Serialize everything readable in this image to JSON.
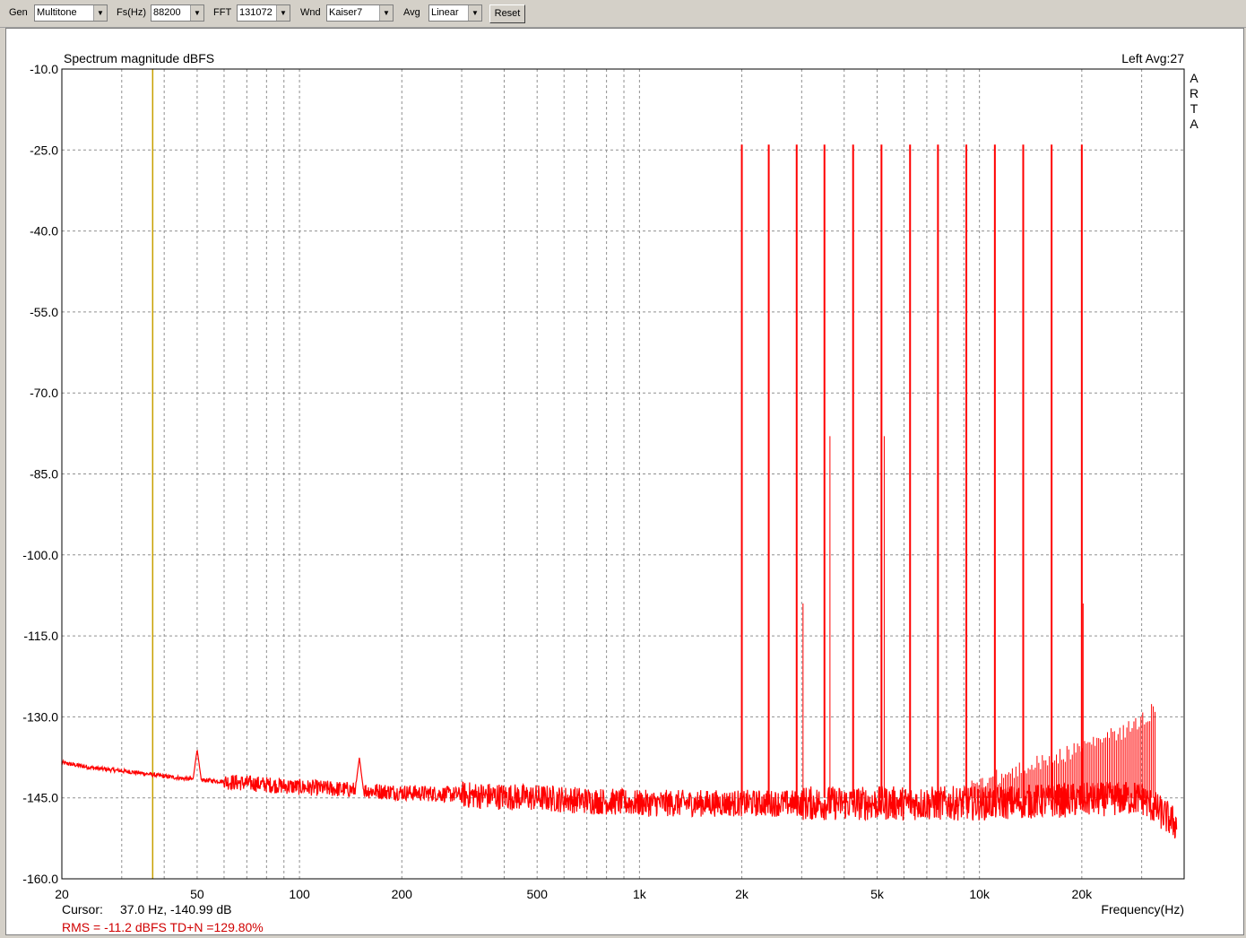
{
  "toolbar": {
    "gen_label": "Gen",
    "gen_value": "Multitone",
    "fs_label": "Fs(Hz)",
    "fs_value": "88200",
    "fft_label": "FFT",
    "fft_value": "131072",
    "wnd_label": "Wnd",
    "wnd_value": "Kaiser7",
    "avg_label": "Avg",
    "avg_value": "Linear",
    "reset_label": "Reset"
  },
  "chart": {
    "title": "Spectrum magnitude dBFS",
    "channel_info": "Left  Avg:27",
    "brand": "ARTA",
    "xlabel": "Frequency(Hz)",
    "cursor_label": "Cursor:",
    "cursor_value": "37.0 Hz, -140.99 dB",
    "rms_text": "RMS =  -11.2 dBFS   TD+N =129.80%"
  },
  "colors": {
    "trace": "#ff0000",
    "cursor": "#c8a000",
    "grid": "#909090",
    "status": "#d00000"
  },
  "chart_data": {
    "type": "line",
    "xscale": "log",
    "xlim": [
      20,
      40000
    ],
    "ylim": [
      -160,
      -10
    ],
    "x_ticks": [
      20,
      50,
      100,
      200,
      500,
      1000,
      2000,
      5000,
      10000,
      20000
    ],
    "x_tick_labels": [
      "20",
      "50",
      "100",
      "200",
      "500",
      "1k",
      "2k",
      "5k",
      "10k",
      "20k"
    ],
    "y_ticks": [
      -10,
      -25,
      -40,
      -55,
      -70,
      -85,
      -100,
      -115,
      -130,
      -145,
      -160
    ],
    "y_tick_labels": [
      "-10.0",
      "-25.0",
      "-40.0",
      "-55.0",
      "-70.0",
      "-85.0",
      "-100.0",
      "-115.0",
      "-130.0",
      "-145.0",
      "-160.0"
    ],
    "grid": true,
    "cursor_hz": 37.0,
    "tones_hz": [
      2000,
      2400,
      2900,
      3500,
      4250,
      5150,
      6250,
      7550,
      9150,
      11100,
      13450,
      16300,
      20000
    ],
    "tone_level_db": -24,
    "noise_floor_db": -145,
    "low_freq_noise": [
      [
        20,
        -138.5
      ],
      [
        25,
        -139.5
      ],
      [
        30,
        -140
      ],
      [
        35,
        -140.5
      ],
      [
        40,
        -141
      ],
      [
        47,
        -141.5
      ],
      [
        100,
        -143
      ],
      [
        200,
        -144
      ],
      [
        500,
        -145
      ],
      [
        1000,
        -146
      ],
      [
        2000,
        -146
      ],
      [
        10000,
        -146
      ],
      [
        30000,
        -145
      ],
      [
        38000,
        -150
      ]
    ],
    "spurs": [
      [
        50,
        -136
      ],
      [
        150,
        -137.5
      ],
      [
        3000,
        -109
      ],
      [
        3600,
        -78
      ],
      [
        5200,
        -78
      ],
      [
        20000,
        -109
      ]
    ],
    "imd_products_envelope": [
      [
        9500,
        -141
      ],
      [
        15000,
        -137
      ],
      [
        22000,
        -133
      ],
      [
        27000,
        -131
      ],
      [
        33000,
        -127
      ]
    ]
  }
}
